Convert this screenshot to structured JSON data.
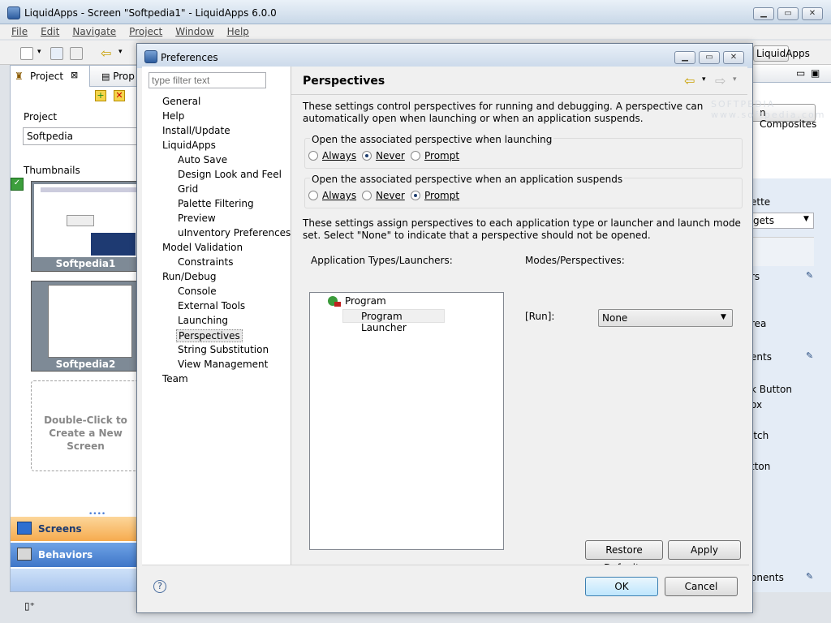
{
  "app": {
    "title": "LiquidApps - Screen \"Softpedia1\" - LiquidApps 6.0.0",
    "menu": [
      "File",
      "Edit",
      "Navigate",
      "Project",
      "Window",
      "Help"
    ],
    "perspective_button": "LiquidApps"
  },
  "left": {
    "tabs": [
      "Project",
      "Prop"
    ],
    "project_label": "Project",
    "project_value": "Softpedia",
    "thumbnails_label": "Thumbnails",
    "thumbs": [
      "Softpedia1",
      "Softpedia2"
    ],
    "new_screen": "Double-Click to Create a New Screen",
    "sections": [
      "Screens",
      "Behaviors"
    ]
  },
  "right": {
    "composites_button": "n Composites",
    "palette_header": "ette",
    "widgets_combo": "gets",
    "rows": [
      "rs",
      "rea",
      "ents",
      "k Button",
      "ox",
      "itch",
      "tton",
      "onents"
    ]
  },
  "dialog": {
    "title": "Preferences",
    "filter_placeholder": "type filter text",
    "tree": [
      {
        "label": "General",
        "level": 0
      },
      {
        "label": "Help",
        "level": 0
      },
      {
        "label": "Install/Update",
        "level": 0
      },
      {
        "label": "LiquidApps",
        "level": 0
      },
      {
        "label": "Auto Save",
        "level": 1
      },
      {
        "label": "Design Look and Feel",
        "level": 1
      },
      {
        "label": "Grid",
        "level": 1
      },
      {
        "label": "Palette Filtering",
        "level": 1
      },
      {
        "label": "Preview",
        "level": 1
      },
      {
        "label": "uInventory Preferences",
        "level": 1
      },
      {
        "label": "Model Validation",
        "level": 0
      },
      {
        "label": "Constraints",
        "level": 1
      },
      {
        "label": "Run/Debug",
        "level": 0
      },
      {
        "label": "Console",
        "level": 1
      },
      {
        "label": "External Tools",
        "level": 1
      },
      {
        "label": "Launching",
        "level": 1
      },
      {
        "label": "Perspectives",
        "level": 1,
        "selected": true
      },
      {
        "label": "String Substitution",
        "level": 1
      },
      {
        "label": "View Management",
        "level": 1
      },
      {
        "label": "Team",
        "level": 0
      }
    ],
    "page_title": "Perspectives",
    "intro": "These settings control perspectives for running and debugging. A perspective can automatically open when launching or when an application suspends.",
    "group1": {
      "label": "Open the associated perspective when launching",
      "options": [
        "Always",
        "Never",
        "Prompt"
      ],
      "selected": "Never"
    },
    "group2": {
      "label": "Open the associated perspective when an application suspends",
      "options": [
        "Always",
        "Never",
        "Prompt"
      ],
      "selected": "Prompt"
    },
    "assign_text": "These settings assign perspectives to each application type or launcher and launch mode set. Select \"None\" to indicate that a perspective should not be opened.",
    "types_label": "Application Types/Launchers:",
    "types_tree": [
      "Program",
      "Program Launcher"
    ],
    "modes_label": "Modes/Perspectives:",
    "run_label": "[Run]:",
    "run_value": "None",
    "restore_defaults": "Restore Defaults",
    "apply": "Apply",
    "ok": "OK",
    "cancel": "Cancel",
    "help_icon": "?"
  },
  "watermark": "SOFTPEDIA www.softpedia.com"
}
